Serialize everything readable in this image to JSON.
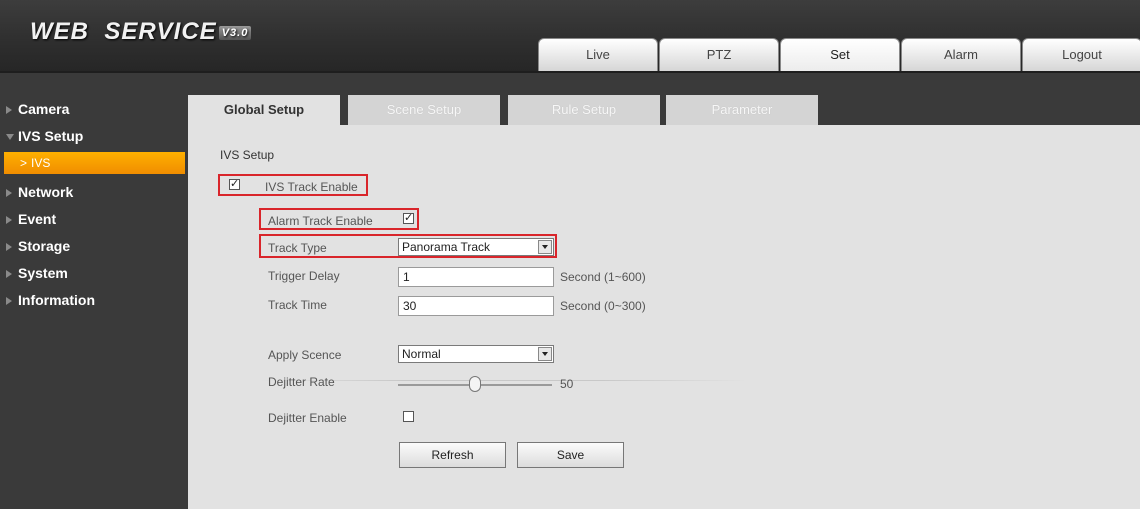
{
  "header": {
    "logo_text": "WEB  SERVICE",
    "logo_version": "V3.0",
    "nav": [
      {
        "label": "Live",
        "active": false
      },
      {
        "label": "PTZ",
        "active": false
      },
      {
        "label": "Set",
        "active": true
      },
      {
        "label": "Alarm",
        "active": false
      },
      {
        "label": "Logout",
        "active": false
      }
    ]
  },
  "sidebar": {
    "items": [
      {
        "label": "Camera",
        "expanded": false
      },
      {
        "label": "IVS Setup",
        "expanded": true
      },
      {
        "label": "Network",
        "expanded": false
      },
      {
        "label": "Event",
        "expanded": false
      },
      {
        "label": "Storage",
        "expanded": false
      },
      {
        "label": "System",
        "expanded": false
      },
      {
        "label": "Information",
        "expanded": false
      }
    ],
    "sub_item": {
      "label": "IVS",
      "chevron": ">",
      "selected": true
    }
  },
  "subtabs": [
    {
      "label": "Global Setup",
      "active": true
    },
    {
      "label": "Scene Setup",
      "active": false
    },
    {
      "label": "Rule Setup",
      "active": false
    },
    {
      "label": "Parameter",
      "active": false
    }
  ],
  "form": {
    "section_title": "IVS Setup",
    "ivs_track_enable": {
      "label": "IVS Track Enable",
      "checked": true
    },
    "alarm_track_enable": {
      "label": "Alarm Track Enable",
      "checked": true
    },
    "track_type": {
      "label": "Track Type",
      "value": "Panorama Track"
    },
    "trigger_delay": {
      "label": "Trigger Delay",
      "value": "1",
      "unit": "Second (1~600)"
    },
    "track_time": {
      "label": "Track Time",
      "value": "30",
      "unit": "Second (0~300)"
    },
    "apply_scene": {
      "label": "Apply Scence",
      "value": "Normal"
    },
    "dejitter_rate": {
      "label": "Dejitter Rate",
      "value": "50",
      "fraction": 0.5
    },
    "dejitter_enable": {
      "label": "Dejitter Enable",
      "checked": false
    },
    "check_mark": "✓",
    "buttons": {
      "refresh": "Refresh",
      "save": "Save"
    }
  },
  "colors": {
    "accent_orange": "#f5a000",
    "highlight_red": "#d9252b",
    "panel_bg": "#e2e2e2",
    "dark_bg": "#3a3a3a"
  }
}
